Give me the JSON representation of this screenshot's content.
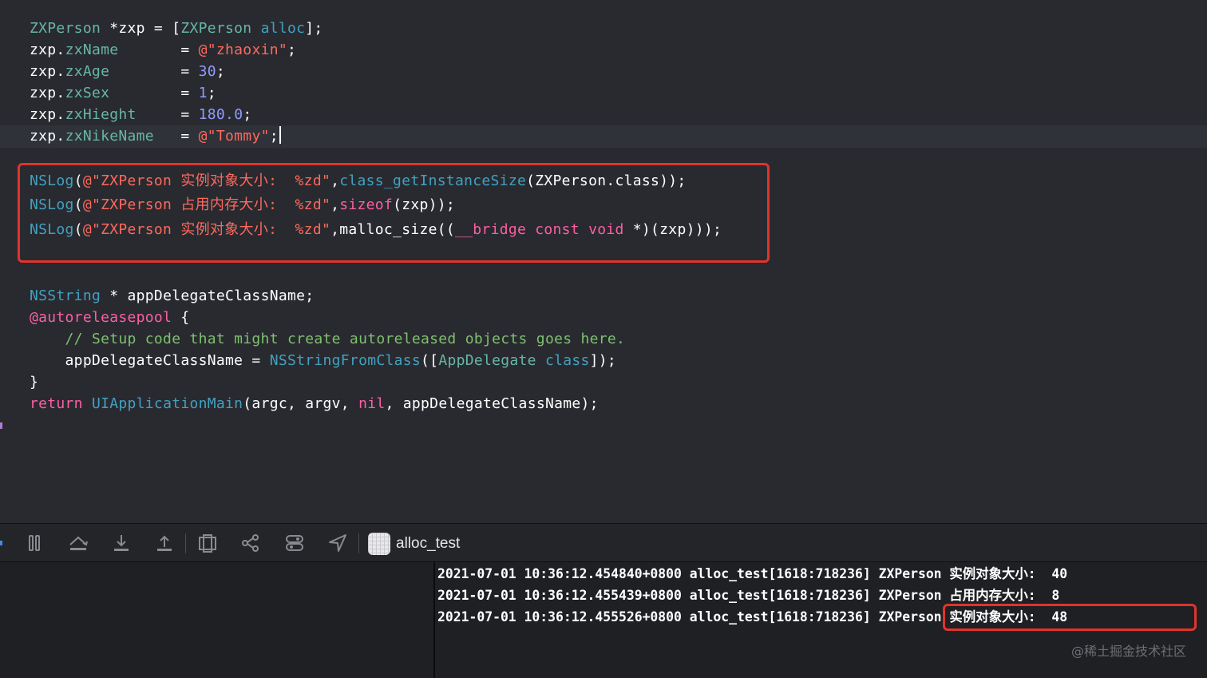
{
  "editor": {
    "lines": [
      [
        {
          "t": "ZXPerson",
          "c": "fn"
        },
        {
          "t": " *zxp = [",
          "c": ""
        },
        {
          "t": "ZXPerson",
          "c": "fn"
        },
        {
          "t": " ",
          "c": ""
        },
        {
          "t": "alloc",
          "c": "sys"
        },
        {
          "t": "];",
          "c": ""
        }
      ],
      [
        {
          "t": "zxp.",
          "c": ""
        },
        {
          "t": "zxName",
          "c": "fn"
        },
        {
          "t": "       = ",
          "c": ""
        },
        {
          "t": "@\"zhaoxin\"",
          "c": "st"
        },
        {
          "t": ";",
          "c": ""
        }
      ],
      [
        {
          "t": "zxp.",
          "c": ""
        },
        {
          "t": "zxAge",
          "c": "fn"
        },
        {
          "t": "        = ",
          "c": ""
        },
        {
          "t": "30",
          "c": "num-blue"
        },
        {
          "t": ";",
          "c": ""
        }
      ],
      [
        {
          "t": "zxp.",
          "c": ""
        },
        {
          "t": "zxSex",
          "c": "fn"
        },
        {
          "t": "        = ",
          "c": ""
        },
        {
          "t": "1",
          "c": "num-blue"
        },
        {
          "t": ";",
          "c": ""
        }
      ],
      [
        {
          "t": "zxp.",
          "c": ""
        },
        {
          "t": "zxHieght",
          "c": "fn"
        },
        {
          "t": "     = ",
          "c": ""
        },
        {
          "t": "180.0",
          "c": "num-blue"
        },
        {
          "t": ";",
          "c": ""
        }
      ],
      [
        {
          "t": "zxp.",
          "c": ""
        },
        {
          "t": "zxNikeName",
          "c": "fn"
        },
        {
          "t": "   = ",
          "c": ""
        },
        {
          "t": "@\"Tommy\"",
          "c": "st"
        },
        {
          "t": ";",
          "c": ""
        }
      ],
      [
        {
          "t": "NSLog",
          "c": "sys"
        },
        {
          "t": "(",
          "c": ""
        },
        {
          "t": "@\"ZXPerson 实例对象大小:  %zd\"",
          "c": "st"
        },
        {
          "t": ",",
          "c": ""
        },
        {
          "t": "class_getInstanceSize",
          "c": "sys"
        },
        {
          "t": "(ZXPerson.class));",
          "c": ""
        }
      ],
      [
        {
          "t": "NSLog",
          "c": "sys"
        },
        {
          "t": "(",
          "c": ""
        },
        {
          "t": "@\"ZXPerson 占用内存大小:  %zd\"",
          "c": "st"
        },
        {
          "t": ",",
          "c": ""
        },
        {
          "t": "sizeof",
          "c": "kw"
        },
        {
          "t": "(zxp));",
          "c": ""
        }
      ],
      [
        {
          "t": "NSLog",
          "c": "sys"
        },
        {
          "t": "(",
          "c": ""
        },
        {
          "t": "@\"ZXPerson 实例对象大小:  %zd\"",
          "c": "st"
        },
        {
          "t": ",malloc_size((",
          "c": ""
        },
        {
          "t": "__bridge const void",
          "c": "kw"
        },
        {
          "t": " *)(zxp)));",
          "c": ""
        }
      ],
      [
        {
          "t": "NSString",
          "c": "sys"
        },
        {
          "t": " * appDelegateClassName;",
          "c": ""
        }
      ],
      [
        {
          "t": "@autoreleasepool",
          "c": "kw"
        },
        {
          "t": " {",
          "c": ""
        }
      ],
      [
        {
          "t": "    // Setup code that might create autoreleased objects goes here.",
          "c": "cmg"
        }
      ],
      [
        {
          "t": "    appDelegateClassName = ",
          "c": ""
        },
        {
          "t": "NSStringFromClass",
          "c": "sys"
        },
        {
          "t": "([",
          "c": ""
        },
        {
          "t": "AppDelegate",
          "c": "fn"
        },
        {
          "t": " ",
          "c": ""
        },
        {
          "t": "class",
          "c": "sys"
        },
        {
          "t": "]);",
          "c": ""
        }
      ],
      [
        {
          "t": "}",
          "c": ""
        }
      ],
      [
        {
          "t": "return",
          "c": "kw"
        },
        {
          "t": " ",
          "c": ""
        },
        {
          "t": "UIApplicationMain",
          "c": "sys"
        },
        {
          "t": "(argc, argv, ",
          "c": ""
        },
        {
          "t": "nil",
          "c": "kw"
        },
        {
          "t": ", appDelegateClassName);",
          "c": ""
        }
      ]
    ]
  },
  "debug_bar": {
    "target_name": "alloc_test",
    "icons": [
      "pause-icon",
      "step-over-icon",
      "step-into-icon",
      "step-out-icon",
      "view-hierarchy-icon",
      "memory-graph-icon",
      "environment-overrides-icon",
      "location-icon"
    ]
  },
  "console": {
    "lines": [
      "2021-07-01 10:36:12.454840+0800 alloc_test[1618:718236] ZXPerson 实例对象大小:  40",
      "2021-07-01 10:36:12.455439+0800 alloc_test[1618:718236] ZXPerson 占用内存大小:  8",
      "2021-07-01 10:36:12.455526+0800 alloc_test[1618:718236] ZXPerson 实例对象大小:  48"
    ],
    "watermark": "@稀土掘金技术社区"
  },
  "colors": {
    "background": "#292a30",
    "highlight": "#e0342c",
    "string": "#fc6a5d",
    "keyword": "#fc5fa3",
    "system": "#41a1c0",
    "project": "#67b7a4"
  }
}
